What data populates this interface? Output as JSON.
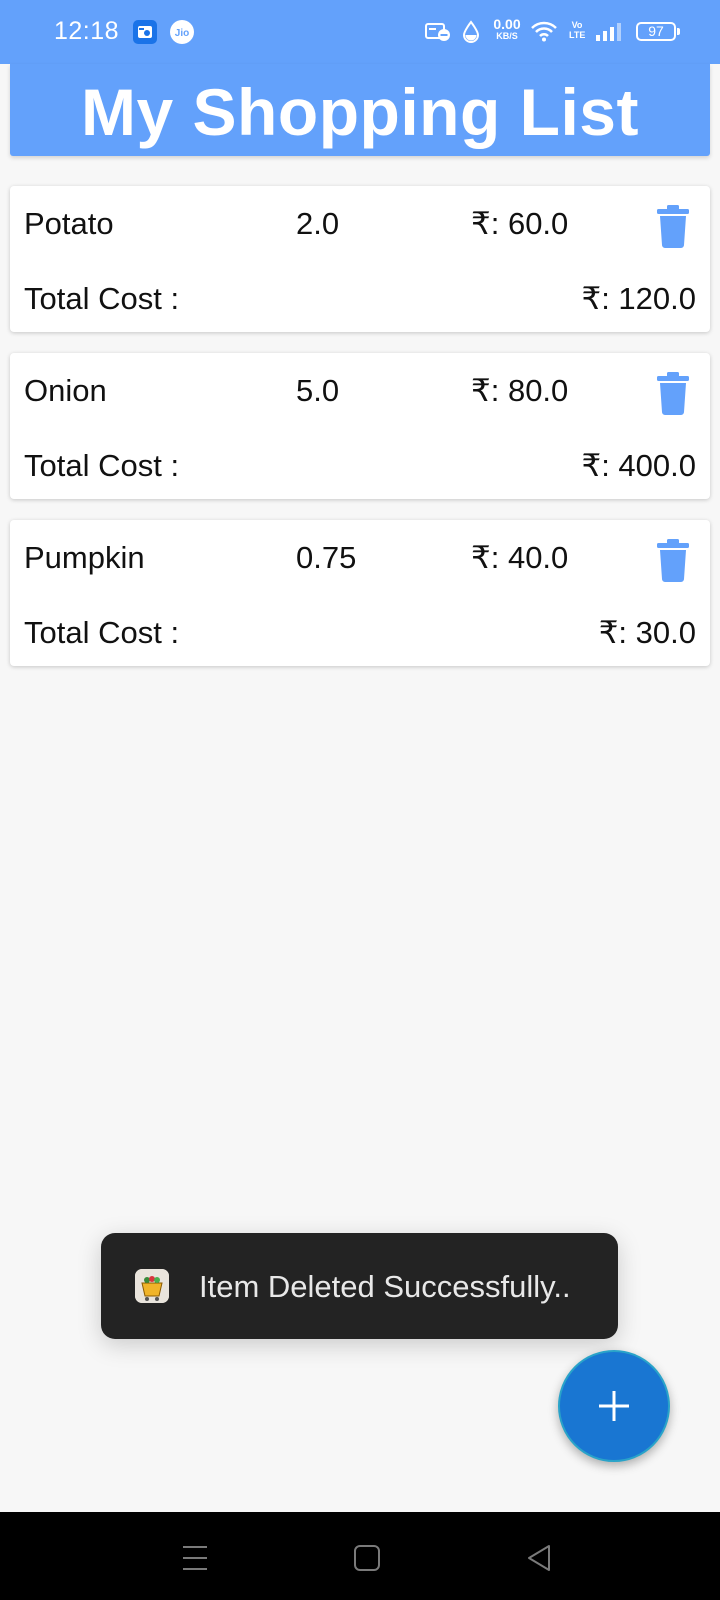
{
  "status_bar": {
    "time": "12:18",
    "net_speed_value": "0.00",
    "net_speed_unit": "KB/S",
    "volte_top": "Vo",
    "volte_bottom": "LTE",
    "battery": "97",
    "icons": [
      "gallery-icon",
      "jio-icon",
      "notification-off-icon",
      "data-saver-icon",
      "wifi-icon",
      "signal-icon",
      "battery-icon"
    ],
    "color": "#63a1fb"
  },
  "header": {
    "title": "My Shopping List",
    "color": "#63a1fb"
  },
  "items": [
    {
      "name": "Potato",
      "quantity": "2.0",
      "price": "₹: 60.0",
      "total_label": "Total Cost :",
      "total_value": "₹: 120.0"
    },
    {
      "name": "Onion",
      "quantity": "5.0",
      "price": "₹: 80.0",
      "total_label": "Total Cost :",
      "total_value": "₹: 400.0"
    },
    {
      "name": "Pumpkin",
      "quantity": "0.75",
      "price": "₹: 40.0",
      "total_label": "Total Cost :",
      "total_value": "₹: 30.0"
    }
  ],
  "toast": {
    "message": "Item Deleted Successfully..",
    "icon": "shopping-basket-icon"
  },
  "fab": {
    "icon": "plus-icon",
    "color": "#1976d2"
  },
  "nav_bar": {
    "buttons": [
      "menu-icon",
      "home-icon",
      "back-icon"
    ]
  }
}
